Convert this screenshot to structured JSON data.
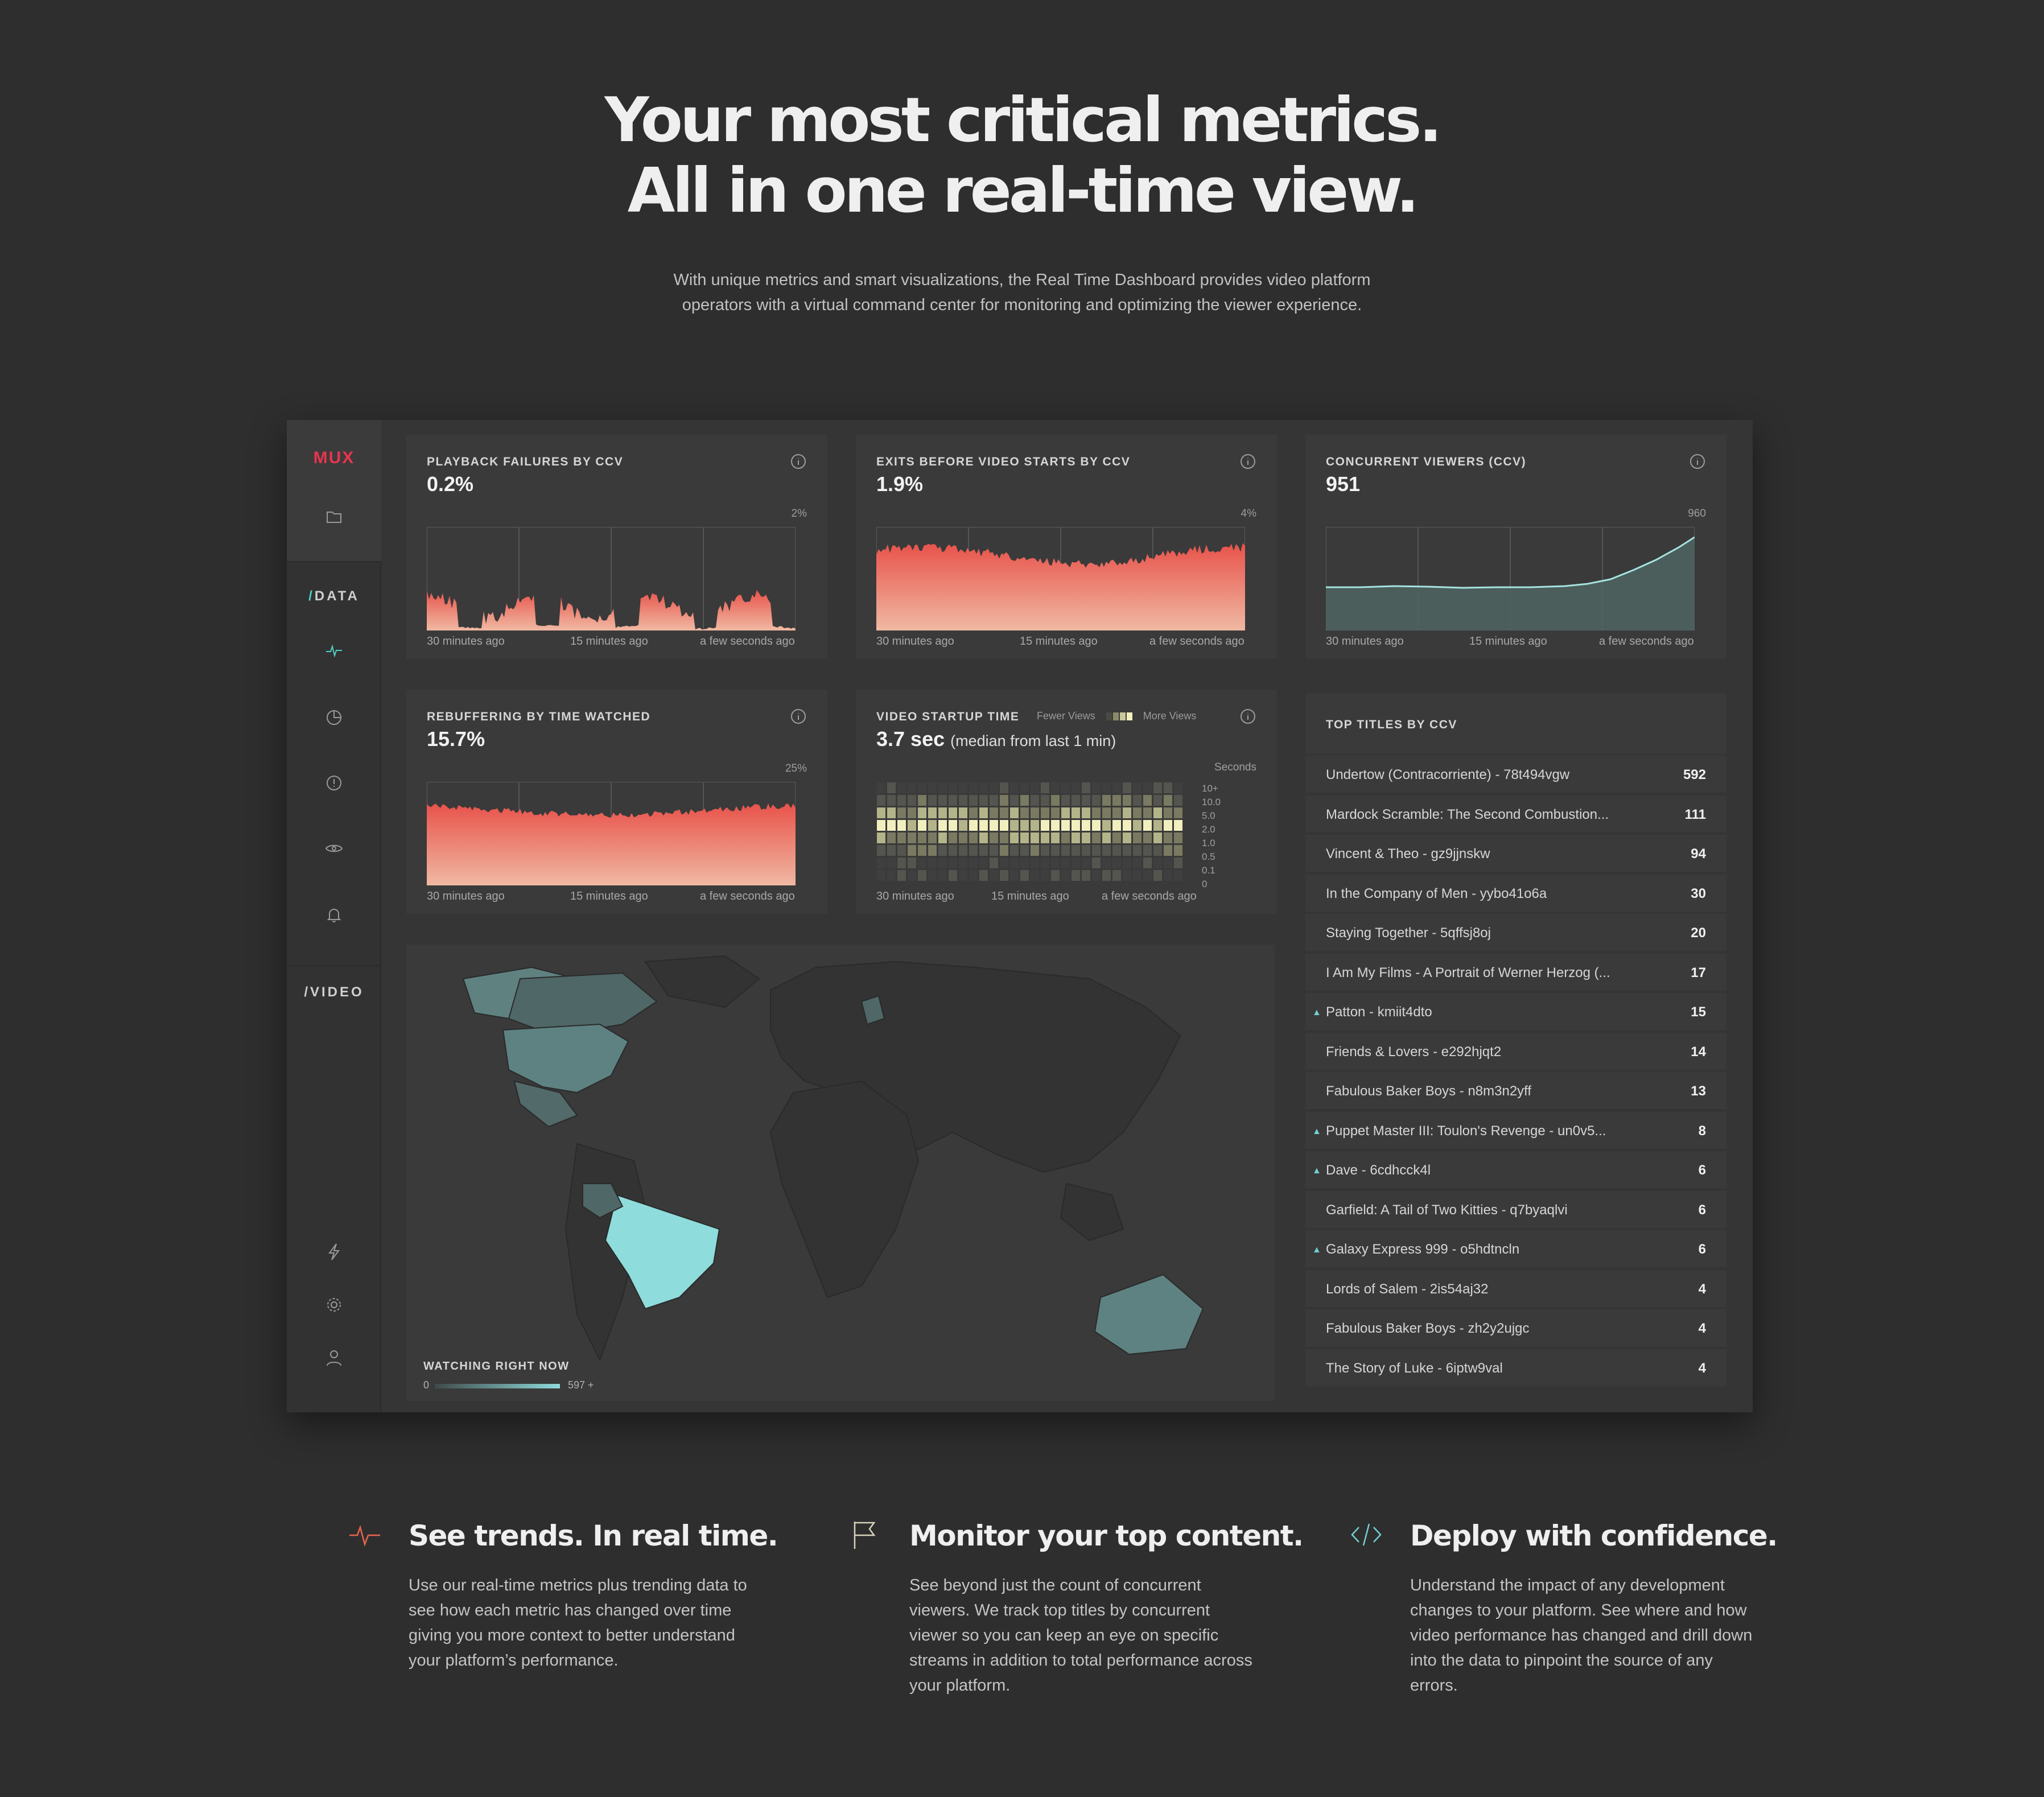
{
  "hero": {
    "title_line1": "Your most critical metrics.",
    "title_line2": "All in one real-time view.",
    "subtitle": "With unique metrics and smart visualizations, the Real Time Dashboard provides video platform operators with a virtual command center for monitoring and optimizing the viewer experience."
  },
  "sidebar": {
    "logo": "MUX",
    "data_label": "DATA",
    "video_label": "VIDEO",
    "slash": "/",
    "icons": [
      "folder-icon",
      "pulse-icon",
      "pie-chart-icon",
      "alert-icon",
      "eye-icon",
      "bell-icon",
      "lightning-icon",
      "gear-icon",
      "user-icon"
    ]
  },
  "time_labels": {
    "start": "30 minutes ago",
    "mid": "15 minutes ago",
    "end": "a few seconds ago"
  },
  "panels": {
    "playback_failures": {
      "title": "PLAYBACK FAILURES BY CCV",
      "value": "0.2%",
      "max": "2%"
    },
    "exits_before_start": {
      "title": "EXITS BEFORE VIDEO STARTS BY CCV",
      "value": "1.9%",
      "max": "4%"
    },
    "concurrent_viewers": {
      "title": "CONCURRENT VIEWERS (CCV)",
      "value": "951",
      "max": "960"
    },
    "rebuffering": {
      "title": "REBUFFERING BY TIME WATCHED",
      "value": "15.7%",
      "max": "25%"
    },
    "startup_time": {
      "title": "VIDEO STARTUP TIME",
      "value": "3.7 sec",
      "value_note": "(median from last 1 min)",
      "legend_fewer": "Fewer Views",
      "legend_more": "More Views",
      "axis_title": "Seconds",
      "y_ticks": [
        "10+",
        "10.0",
        "5.0",
        "2.0",
        "1.0",
        "0.5",
        "0.1",
        "0"
      ]
    }
  },
  "map": {
    "legend_title": "WATCHING RIGHT NOW",
    "legend_min": "0",
    "legend_max": "597 +"
  },
  "top_titles": {
    "header": "TOP TITLES BY CCV",
    "rows": [
      {
        "name": "Undertow (Contracorriente) - 78t494vgw",
        "count": "592",
        "trending": false
      },
      {
        "name": "Mardock Scramble: The Second Combustion...",
        "count": "111",
        "trending": false
      },
      {
        "name": "Vincent & Theo - gz9jjnskw",
        "count": "94",
        "trending": false
      },
      {
        "name": "In the Company of Men - yybo41o6a",
        "count": "30",
        "trending": false
      },
      {
        "name": "Staying Together - 5qffsj8oj",
        "count": "20",
        "trending": false
      },
      {
        "name": "I Am My Films - A Portrait of Werner Herzog (...",
        "count": "17",
        "trending": false
      },
      {
        "name": "Patton - kmiit4dto",
        "count": "15",
        "trending": true
      },
      {
        "name": "Friends & Lovers - e292hjqt2",
        "count": "14",
        "trending": false
      },
      {
        "name": "Fabulous Baker Boys - n8m3n2yff",
        "count": "13",
        "trending": false
      },
      {
        "name": "Puppet Master III: Toulon's Revenge - un0v5...",
        "count": "8",
        "trending": true
      },
      {
        "name": "Dave - 6cdhcck4l",
        "count": "6",
        "trending": true
      },
      {
        "name": "Garfield: A Tail of Two Kitties - q7byaqlvi",
        "count": "6",
        "trending": false
      },
      {
        "name": "Galaxy Express 999 - o5hdtncln",
        "count": "6",
        "trending": true
      },
      {
        "name": "Lords of Salem - 2is54aj32",
        "count": "4",
        "trending": false
      },
      {
        "name": "Fabulous Baker Boys - zh2y2ujgc",
        "count": "4",
        "trending": false
      },
      {
        "name": "The Story of Luke - 6iptw9val",
        "count": "4",
        "trending": false
      }
    ]
  },
  "features": [
    {
      "icon": "pulse-icon",
      "title": "See trends. In real time.",
      "body": "Use our real-time metrics plus trending data to see how each metric has changed over time giving you more context to better understand your platform’s performance."
    },
    {
      "icon": "flag-icon",
      "title": "Monitor your top content.",
      "body": "See beyond just the count of concurrent viewers. We track top titles by concurrent viewer so you can keep an eye on specific streams in addition to total performance across your platform."
    },
    {
      "icon": "code-icon",
      "title": "Deploy with confidence.",
      "body": "Understand the impact of any development changes to your platform. See where and how video performance has changed and drill down into the data to pinpoint the source of any errors."
    }
  ],
  "colors": {
    "accent_red": "#e8524a",
    "accent_teal": "#74cfd0",
    "logo": "#e8344e",
    "background": "#2e2e2e"
  }
}
